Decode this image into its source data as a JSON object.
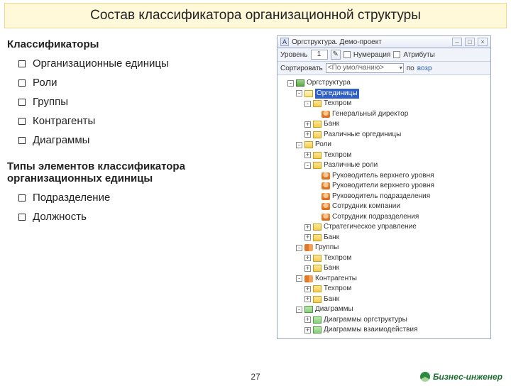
{
  "title": "Состав классификатора организационной структуры",
  "left": {
    "heading1": "Классификаторы",
    "bullets1": [
      "Организационные единицы",
      "Роли",
      "Группы",
      "Контрагенты",
      "Диаграммы"
    ],
    "heading2": "Типы элементов классификатора организационных единицы",
    "bullets2": [
      "Подразделение",
      "Должность"
    ]
  },
  "panel": {
    "window_title": "Оргструктура. Демо-проект",
    "toolbar": {
      "level_label": "Уровень",
      "level_value": "1",
      "numbering_label": "Нумерация",
      "attrib_label": "Атрибуты",
      "sort_label": "Сортировать",
      "sort_value": "<По умолчанию>",
      "asc_label": "по",
      "asc_icon": "возр"
    },
    "tree": [
      {
        "d": 0,
        "pm": "-",
        "ic": "root",
        "t": "Оргструктура"
      },
      {
        "d": 1,
        "pm": "-",
        "ic": "folder-o",
        "t": "Оргединицы",
        "sel": true
      },
      {
        "d": 2,
        "pm": "-",
        "ic": "folder",
        "t": "Техпром"
      },
      {
        "d": 3,
        "pm": "",
        "ic": "person",
        "t": "Генеральный директор"
      },
      {
        "d": 2,
        "pm": "+",
        "ic": "folder",
        "t": "Банк"
      },
      {
        "d": 2,
        "pm": "+",
        "ic": "folder",
        "t": "Различные оргединицы"
      },
      {
        "d": 1,
        "pm": "-",
        "ic": "folder",
        "t": "Роли"
      },
      {
        "d": 2,
        "pm": "+",
        "ic": "folder",
        "t": "Техпром"
      },
      {
        "d": 2,
        "pm": "-",
        "ic": "folder",
        "t": "Различные роли"
      },
      {
        "d": 3,
        "pm": "",
        "ic": "person",
        "t": "Руководитель верхнего уровня"
      },
      {
        "d": 3,
        "pm": "",
        "ic": "person",
        "t": "Руководители верхнего уровня"
      },
      {
        "d": 3,
        "pm": "",
        "ic": "person",
        "t": "Руководитель подразделения"
      },
      {
        "d": 3,
        "pm": "",
        "ic": "person",
        "t": "Сотрудник компании"
      },
      {
        "d": 3,
        "pm": "",
        "ic": "person",
        "t": "Сотрудник подразделения"
      },
      {
        "d": 2,
        "pm": "+",
        "ic": "folder",
        "t": "Стратегическое управление"
      },
      {
        "d": 2,
        "pm": "+",
        "ic": "folder",
        "t": "Банк"
      },
      {
        "d": 1,
        "pm": "-",
        "ic": "group",
        "t": "Группы"
      },
      {
        "d": 2,
        "pm": "+",
        "ic": "folder",
        "t": "Техпром"
      },
      {
        "d": 2,
        "pm": "+",
        "ic": "folder",
        "t": "Банк"
      },
      {
        "d": 1,
        "pm": "-",
        "ic": "group",
        "t": "Контрагенты"
      },
      {
        "d": 2,
        "pm": "+",
        "ic": "folder",
        "t": "Техпром"
      },
      {
        "d": 2,
        "pm": "+",
        "ic": "folder",
        "t": "Банк"
      },
      {
        "d": 1,
        "pm": "-",
        "ic": "diag",
        "t": "Диаграммы"
      },
      {
        "d": 2,
        "pm": "+",
        "ic": "diag",
        "t": "Диаграммы оргструктуры"
      },
      {
        "d": 2,
        "pm": "+",
        "ic": "diag",
        "t": "Диаграммы взаимодействия"
      }
    ]
  },
  "page_number": "27",
  "brand": "Бизнес-инженер"
}
